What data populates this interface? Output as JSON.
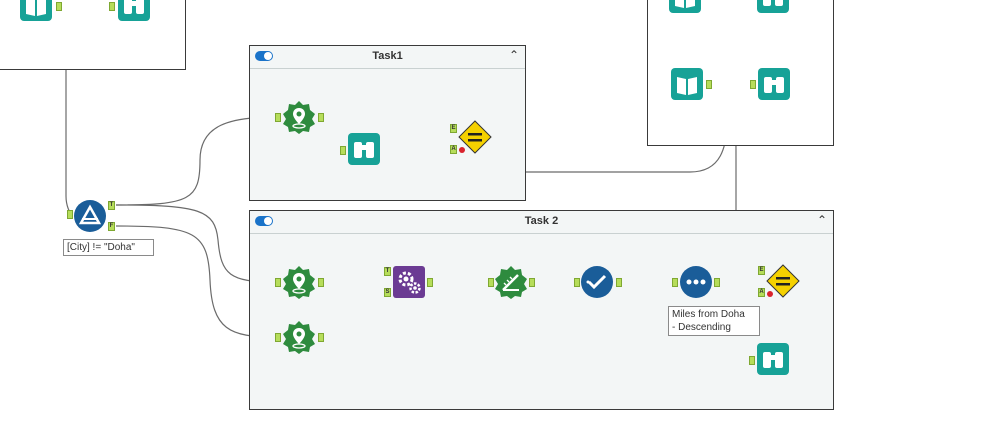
{
  "containers": {
    "task1": {
      "title": "Task1",
      "collapse_glyph": "⌃"
    },
    "task2": {
      "title": "Task 2",
      "collapse_glyph": "⌃"
    }
  },
  "filter_tool": {
    "annotation": "[City] != \"Doha\"",
    "true_anchor": "T",
    "false_anchor": "F"
  },
  "spatial_process": {
    "target_anchor": "T",
    "source_anchor": "S"
  },
  "join_anchors": {
    "left": "E",
    "right": "A"
  },
  "sort_tool": {
    "annotation": "Miles from Doha\n- Descending"
  },
  "icons": {
    "spatial_create": "map-pin-icon",
    "browse": "binoculars-icon",
    "filter": "filter-icon",
    "spatial_match": "gears-icon",
    "distance": "ruler-icon",
    "summarize": "check-icon",
    "sort": "dots-icon",
    "book": "book-icon",
    "test": "equals-icon"
  },
  "colors": {
    "spatial_green": "#2e8b3e",
    "browse_teal": "#17a297",
    "filter_blue": "#1a5d99",
    "process_purple": "#6b3b93",
    "test_yellow": "#f5d100",
    "anchor_green": "#b6dd5a",
    "toggle_blue": "#1a73c9"
  }
}
